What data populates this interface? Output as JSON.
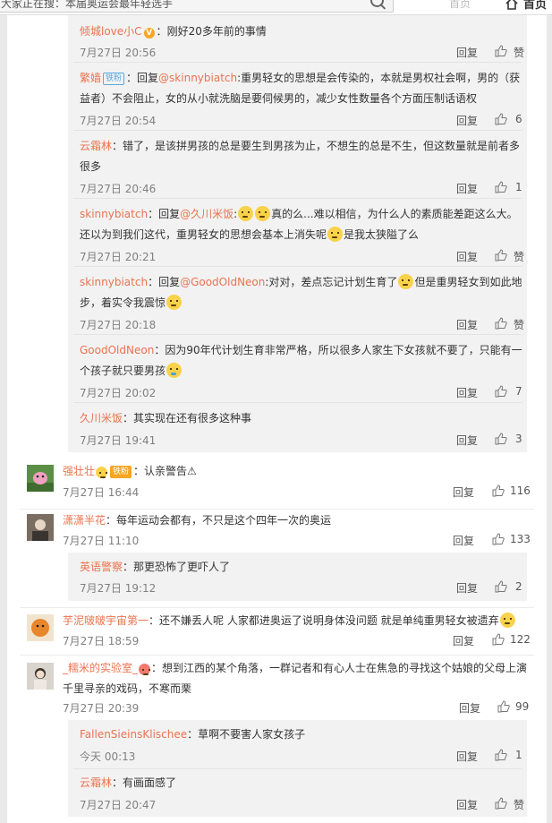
{
  "topbar": {
    "search_placeholder": "大家正在搜：本届奥运会最年轻选手",
    "link_hidden": "首页",
    "home_label": "首页"
  },
  "ui": {
    "reply_label": "回复",
    "like_label": "赞"
  },
  "nested_group_1": [
    {
      "user": "倾城love小C",
      "badge": "V",
      "sep": "：",
      "text": "刚好20多年前的事情",
      "time": "7月27日 20:56",
      "likes": ""
    },
    {
      "user": "繁嫱",
      "badge": "铁粉",
      "prefix": "：回复",
      "mention": "@skinnybiatch",
      "text": ":重男轻女的思想是会传染的，本就是男权社会啊，男的（获益者）不会阻止，女的从小就洗脑是要伺候男的，减少女性数量各个方面压制话语权",
      "time": "7月27日 20:54",
      "likes": "6"
    },
    {
      "user": "云霜林",
      "sep": "：",
      "text": "错了，是该拼男孩的总是要生到男孩为止，不想生的总是不生，但这数量就是前者多很多",
      "time": "7月27日 20:46",
      "likes": "1"
    },
    {
      "user": "skinnybiatch",
      "prefix": "：回复",
      "mention": "@久川米饭",
      "text1": ":",
      "text2": "真的么...难以相信，为什么人的素质能差距这么大。还以为到我们这代，重男轻女的思想会基本上消失呢",
      "text3": "是我太狭隘了么",
      "time": "7月27日 20:21",
      "likes": ""
    },
    {
      "user": "skinnybiatch",
      "prefix": "：回复",
      "mention": "@GoodOldNeon",
      "text1": ":对对，差点忘记计划生育了",
      "text2": "但是重男轻女到如此地步，着实令我震惊",
      "time": "7月27日 20:18",
      "likes": ""
    },
    {
      "user": "GoodOldNeon",
      "sep": "：",
      "text": "因为90年代计划生育非常严格，所以很多人家生下女孩就不要了，只能有一个孩子就只要男孩",
      "time": "7月27日 20:02",
      "likes": "7"
    },
    {
      "user": "久川米饭",
      "sep": "：",
      "text": "其实现在还有很多这种事",
      "time": "7月27日 19:41",
      "likes": "3"
    }
  ],
  "comments": [
    {
      "user": "强壮壮",
      "badge": "铁粉",
      "sep": "：",
      "text": "认亲警告⚠",
      "time": "7月27日 16:44",
      "likes": "116"
    },
    {
      "user": "潇潇半花",
      "sep": "：",
      "text": "每年运动会都有，不只是这个四年一次的奥运",
      "time": "7月27日 11:10",
      "likes": "133"
    },
    {
      "user": "芋泥啵啵宇宙第一",
      "sep": "：",
      "text": "还不嫌丢人呢 人家都进奥运了说明身体没问题 就是单纯重男轻女被遗弃",
      "time": "7月27日 18:59",
      "likes": "122"
    },
    {
      "user": "_糯米的实验室_",
      "sep": "：",
      "text": "想到江西的某个角落，一群记者和有心人士在焦急的寻找这个姑娘的父母上演千里寻亲的戏码，不寒而栗",
      "time": "7月27日 20:39",
      "likes": "99"
    }
  ],
  "nested_group_2": [
    {
      "user": "英语警察",
      "sep": "：",
      "text": "那更恐怖了更吓人了",
      "time": "7月27日 19:12",
      "likes": "2"
    }
  ],
  "nested_group_3": [
    {
      "user": "FallenSieinsKlischee",
      "sep": "：",
      "text": "草啊不要害人家女孩子",
      "time": "今天 00:13",
      "likes": "1"
    },
    {
      "user": "云霜林",
      "sep": "：",
      "text": "有画面感了",
      "time": "7月27日 20:47",
      "likes": ""
    }
  ],
  "colors": {
    "username": "#eb7350",
    "muted": "#808080",
    "nested_bg": "#f2f2f2"
  }
}
